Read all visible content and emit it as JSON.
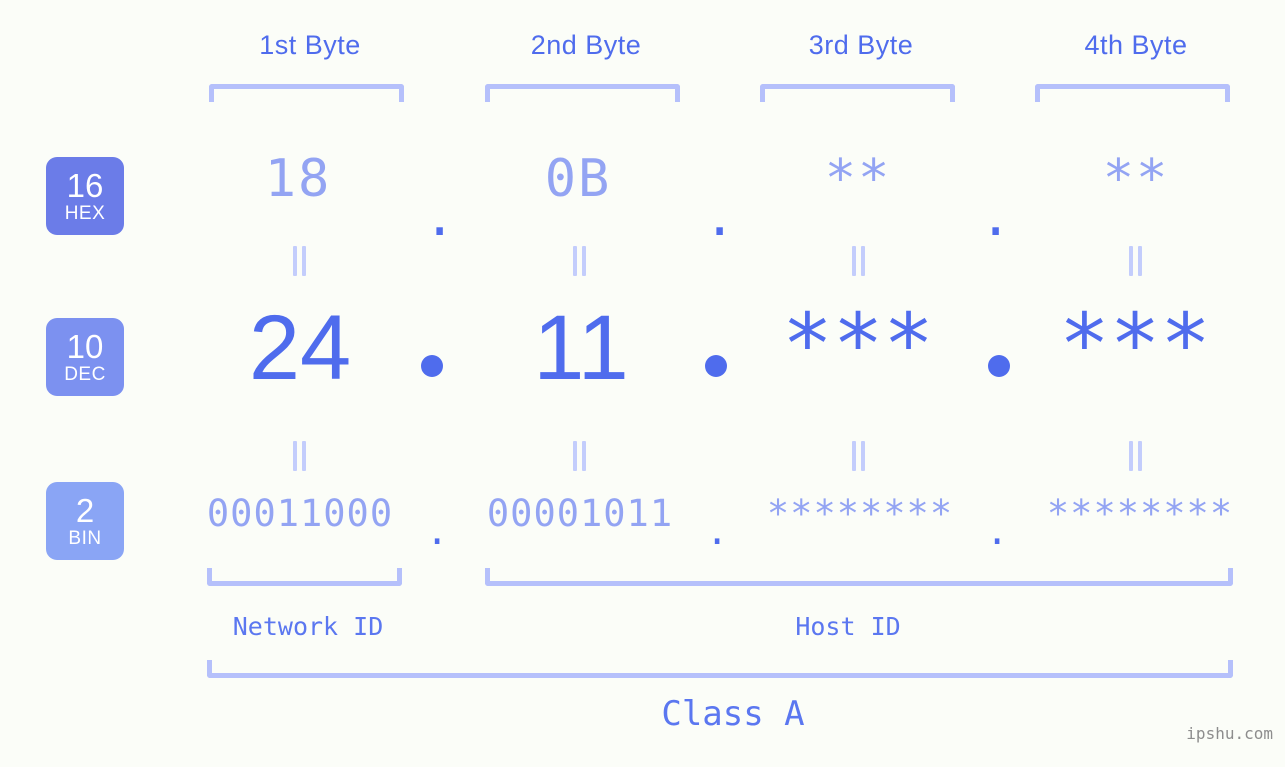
{
  "headers": [
    {
      "label": "1st Byte"
    },
    {
      "label": "2nd Byte"
    },
    {
      "label": "3rd Byte"
    },
    {
      "label": "4th Byte"
    }
  ],
  "bases": [
    {
      "num": "16",
      "name": "HEX",
      "color": "#6b7ce8"
    },
    {
      "num": "10",
      "name": "DEC",
      "color": "#7c91f0"
    },
    {
      "num": "2",
      "name": "BIN",
      "color": "#8aa5f5"
    }
  ],
  "rows": {
    "hex": {
      "base_num": "16",
      "base_name": "HEX",
      "values": [
        "18",
        "0B",
        "**",
        "**"
      ],
      "separators": [
        ".",
        ".",
        "."
      ]
    },
    "dec": {
      "base_num": "10",
      "base_name": "DEC",
      "values": [
        "24",
        "11",
        "***",
        "***"
      ],
      "separators": [
        "",
        "",
        ""
      ]
    },
    "bin": {
      "base_num": "2",
      "base_name": "BIN",
      "values": [
        "00011000",
        "00001011",
        "********",
        "********"
      ],
      "separators": [
        ".",
        ".",
        "."
      ]
    }
  },
  "connectors": {
    "glyph": "||",
    "meaning": "equals"
  },
  "sections": {
    "network_id": "Network ID",
    "host_id": "Host ID",
    "class": "Class A"
  },
  "watermark": "ipshu.com",
  "colors": {
    "background": "#fbfdf8",
    "accent_strong": "#4f6ced",
    "accent_light": "#93a4f3",
    "bracket": "#b5c0fb",
    "connector": "#c3cdfc",
    "watermark": "#8d8d8d"
  }
}
